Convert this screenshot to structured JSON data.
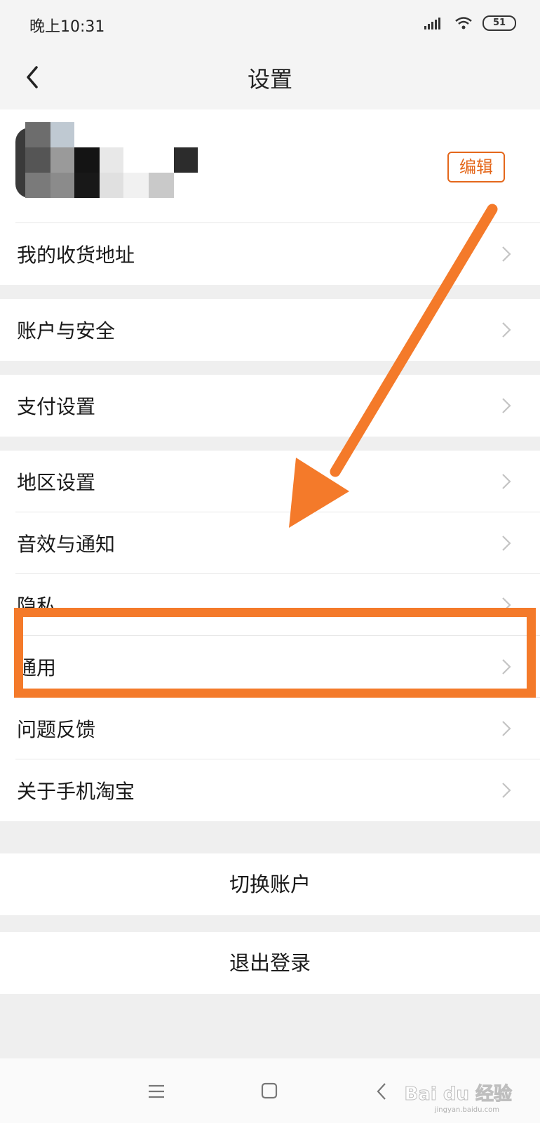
{
  "status_bar": {
    "time": "晚上10:31",
    "battery": "51"
  },
  "header": {
    "title": "设置"
  },
  "profile": {
    "edit_label": "编辑"
  },
  "groups": [
    {
      "items": [
        {
          "label": "我的收货地址"
        }
      ]
    },
    {
      "items": [
        {
          "label": "账户与安全"
        }
      ]
    },
    {
      "items": [
        {
          "label": "支付设置"
        }
      ]
    },
    {
      "items": [
        {
          "label": "地区设置"
        },
        {
          "label": "音效与通知"
        },
        {
          "label": "隐私"
        },
        {
          "label": "通用"
        },
        {
          "label": "问题反馈"
        },
        {
          "label": "关于手机淘宝"
        }
      ]
    }
  ],
  "actions": {
    "switch_account": "切换账户",
    "logout": "退出登录"
  },
  "annotation": {
    "color": "#f47a2a",
    "highlighted_item": "通用"
  },
  "watermark": {
    "text": "Bai du 经验",
    "sub": "jingyan.baidu.com"
  }
}
